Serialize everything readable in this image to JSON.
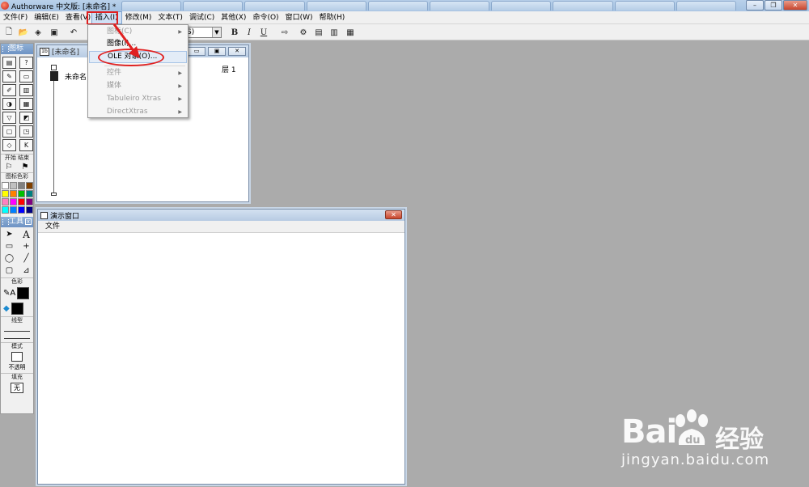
{
  "app": {
    "title": "Authorware 中文版: [未命名] *",
    "window_controls": {
      "minimize": "–",
      "maximize": "❐",
      "close": "✕"
    }
  },
  "menubar": {
    "items": [
      "文件(F)",
      "编辑(E)",
      "查看(V)",
      "插入(I)",
      "修改(M)",
      "文本(T)",
      "调试(C)",
      "其他(X)",
      "命令(O)",
      "窗口(W)",
      "帮助(H)"
    ],
    "active_item": "插入(I)"
  },
  "toolbar": {
    "font_value": "S)",
    "bold": "B",
    "italic": "I",
    "underline": "U"
  },
  "insert_menu": {
    "items": [
      {
        "label": "图标(C)",
        "disabled": true,
        "submenu": true
      },
      {
        "label": "图像(I)...",
        "disabled": false,
        "submenu": false
      },
      {
        "label": "OLE 对象(O)...",
        "disabled": false,
        "submenu": false,
        "highlighted": true
      },
      {
        "label": "控件",
        "disabled": true,
        "submenu": true
      },
      {
        "label": "媒体",
        "disabled": true,
        "submenu": true
      },
      {
        "label": "Tabuleiro Xtras",
        "disabled": true,
        "submenu": true
      },
      {
        "label": "DirectXtras",
        "disabled": true,
        "submenu": true
      }
    ]
  },
  "icon_palette": {
    "title": "图标",
    "start_label": "开始",
    "end_label": "结束",
    "color_label": "图标色彩",
    "icon_colors": [
      "#ffffff",
      "#c0c0c0",
      "#808080",
      "#804000",
      "#ffff00",
      "#ff8000",
      "#00c000",
      "#008080",
      "#ff80c0",
      "#ff00ff",
      "#ff0000",
      "#800080",
      "#00ffff",
      "#0080ff",
      "#0000ff",
      "#000080"
    ]
  },
  "tools_palette": {
    "title": "工具",
    "color_label": "色彩",
    "line_label": "线型",
    "mode_label": "模式",
    "mode_value": "不透明",
    "fill_label": "填充",
    "fill_value": "无"
  },
  "flow_window": {
    "title": "[未命名]",
    "item_label": "未命名",
    "layer_label": "层 1"
  },
  "presentation_window": {
    "title": "演示窗口",
    "menu_file": "文件"
  },
  "watermark": {
    "logo": "Bai",
    "logo_suffix": "du",
    "cn": "经验",
    "url": "jingyan.baidu.com"
  }
}
